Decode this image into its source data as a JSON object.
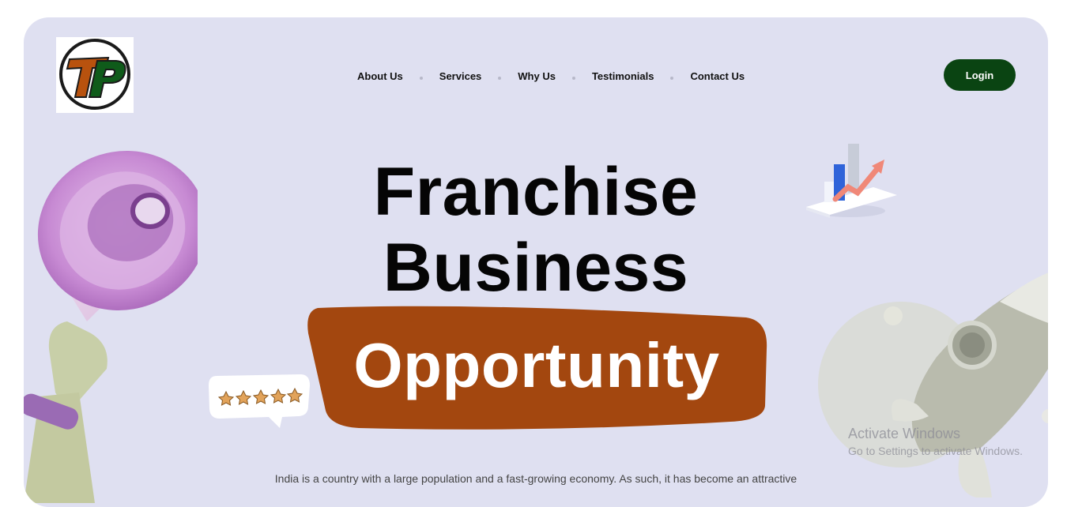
{
  "brand": {
    "logo_text": "TP"
  },
  "nav": {
    "items": [
      {
        "label": "About Us"
      },
      {
        "label": "Services"
      },
      {
        "label": "Why Us"
      },
      {
        "label": "Testimonials"
      },
      {
        "label": "Contact Us"
      }
    ]
  },
  "header": {
    "login_label": "Login"
  },
  "hero": {
    "line1": "Franchise",
    "line2": "Business",
    "highlight": "Opportunity",
    "description": "India is a country with a large population and a fast-growing economy. As such, it has become an attractive"
  },
  "rating": {
    "stars": 5
  },
  "os_overlay": {
    "title": "Activate Windows",
    "subtitle": "Go to Settings to activate Windows."
  },
  "colors": {
    "background": "#dfe0f1",
    "login_button": "#0a4412",
    "highlight_brush": "#a3470f",
    "logo_orange": "#b8520e",
    "logo_green": "#0f5b1a"
  }
}
